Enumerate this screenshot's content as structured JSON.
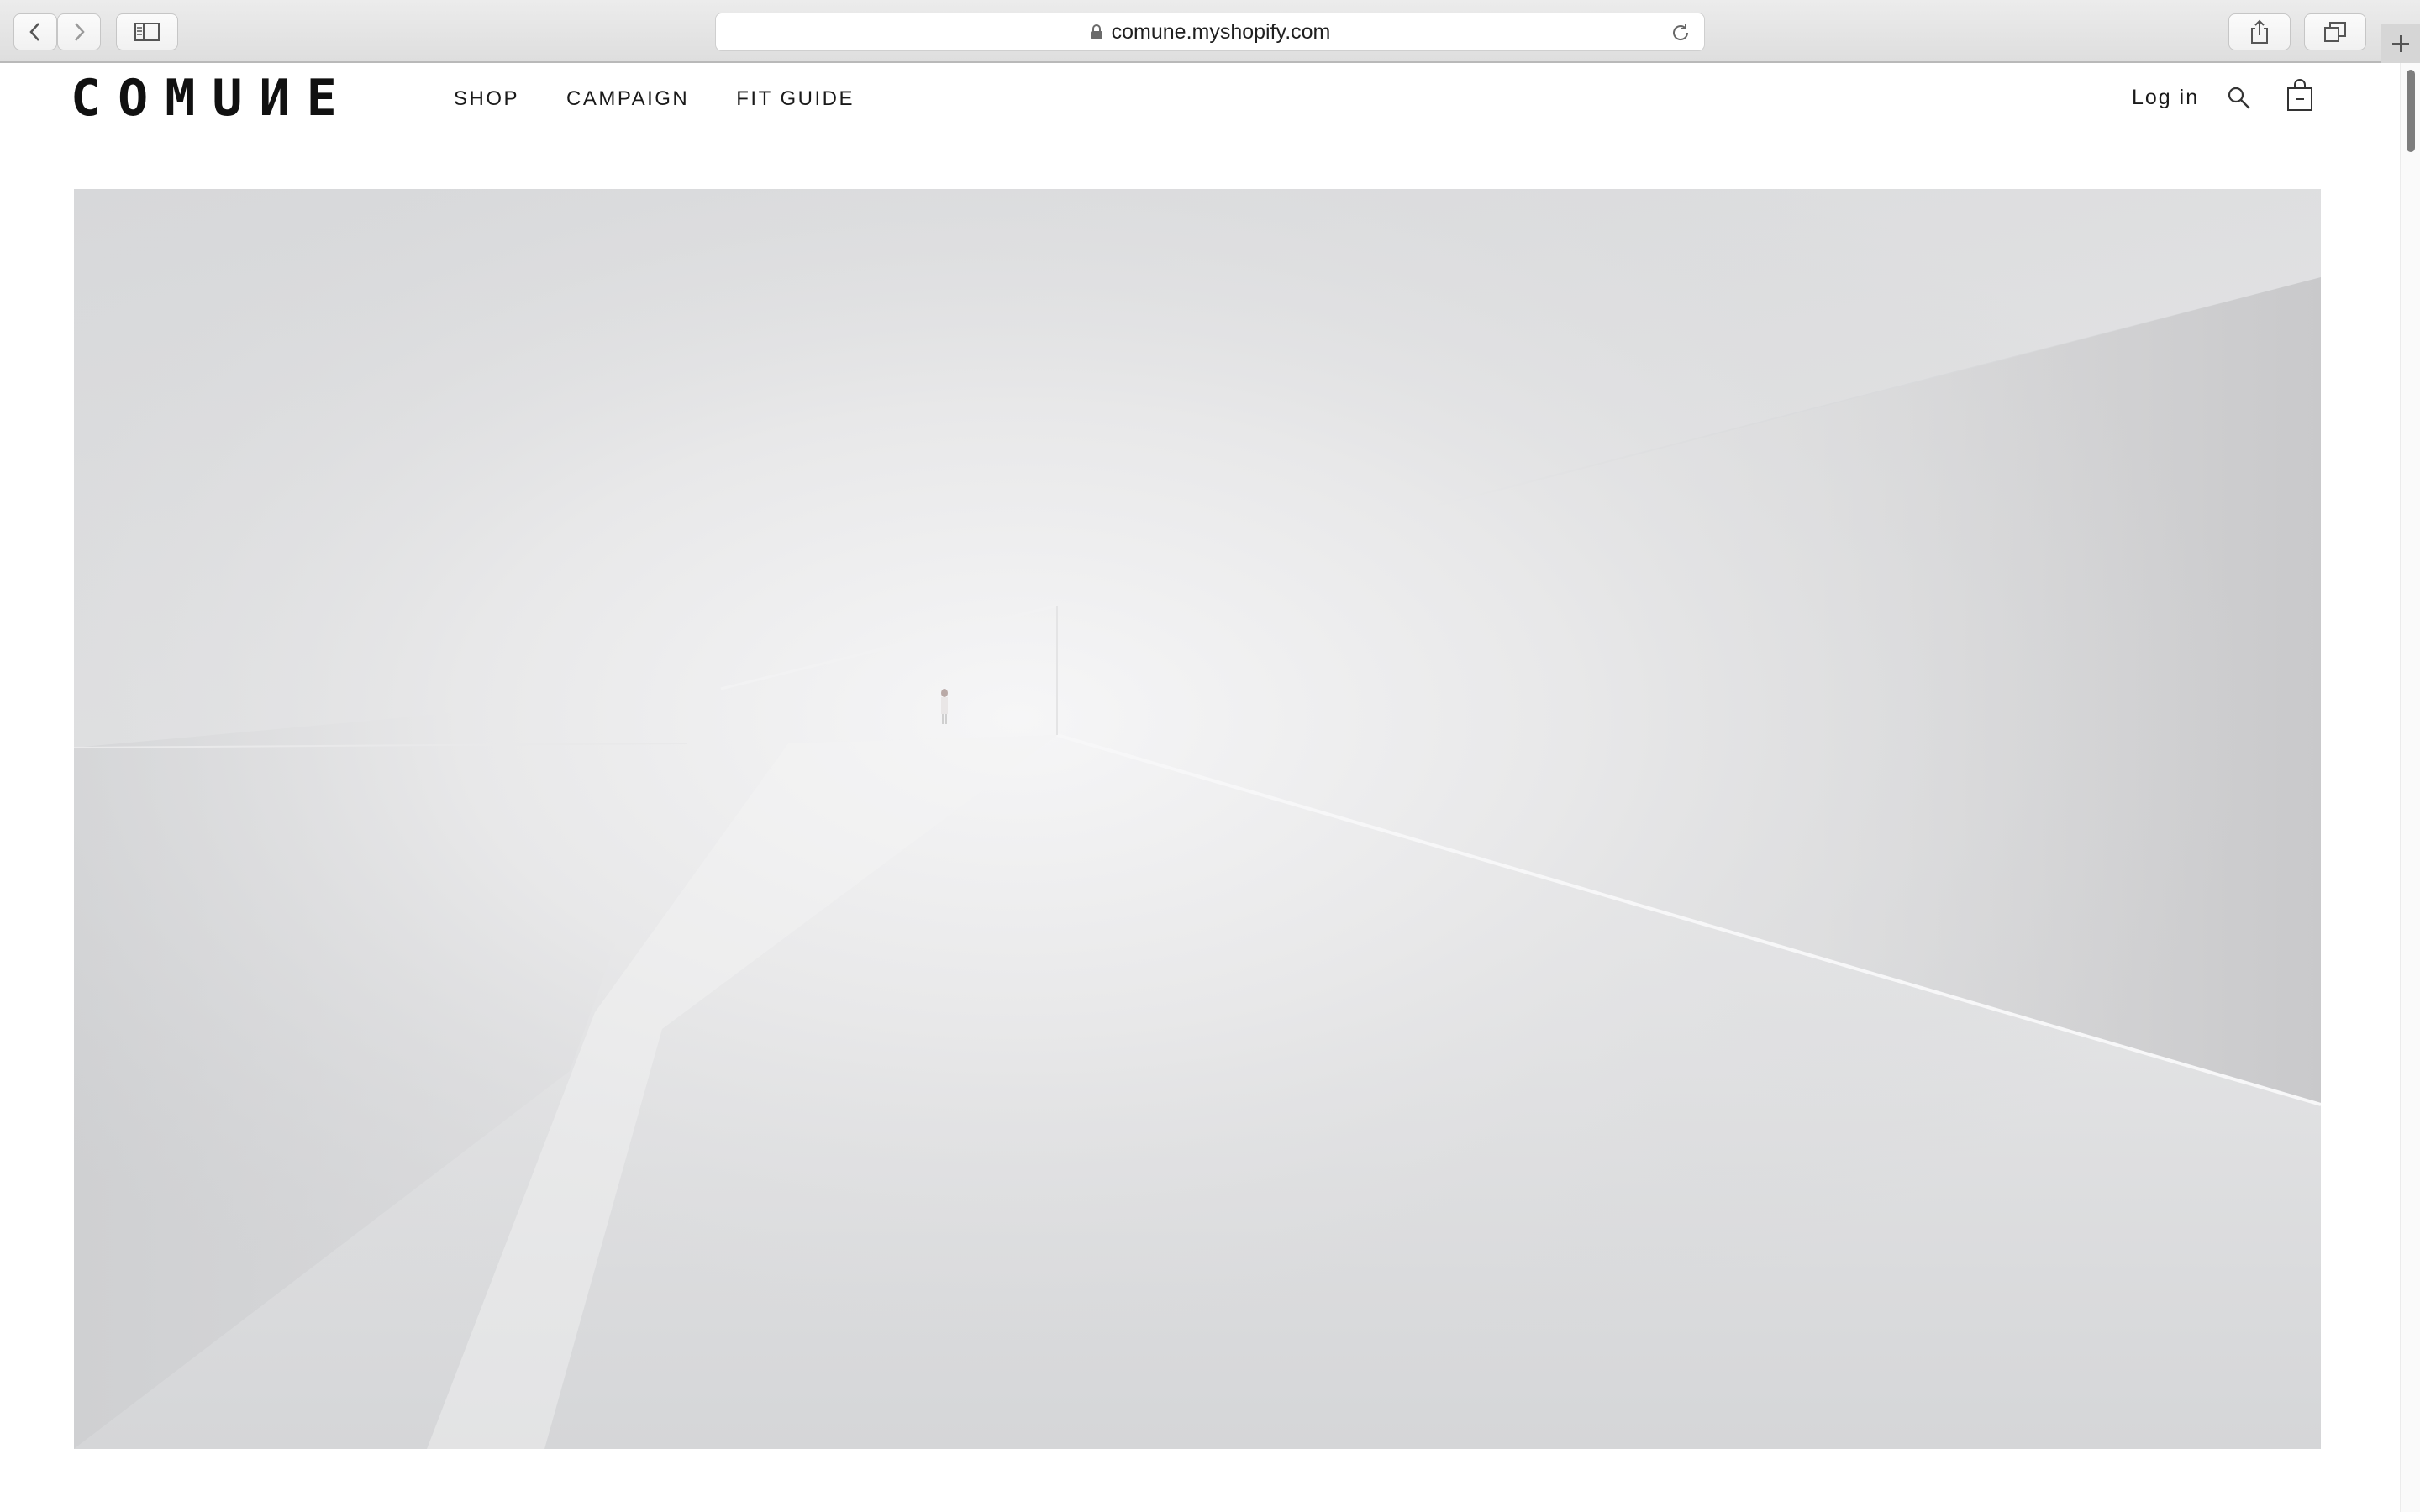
{
  "browser": {
    "url": "comune.myshopify.com"
  },
  "site": {
    "logo": "COMUИE",
    "nav": [
      {
        "label": "SHOP"
      },
      {
        "label": "CAMPAIGN"
      },
      {
        "label": "FIT GUIDE"
      }
    ],
    "login_label": "Log in"
  },
  "colors": {
    "text": "#1a1a1a",
    "background": "#ffffff",
    "hero_base": "#d8d9db"
  }
}
